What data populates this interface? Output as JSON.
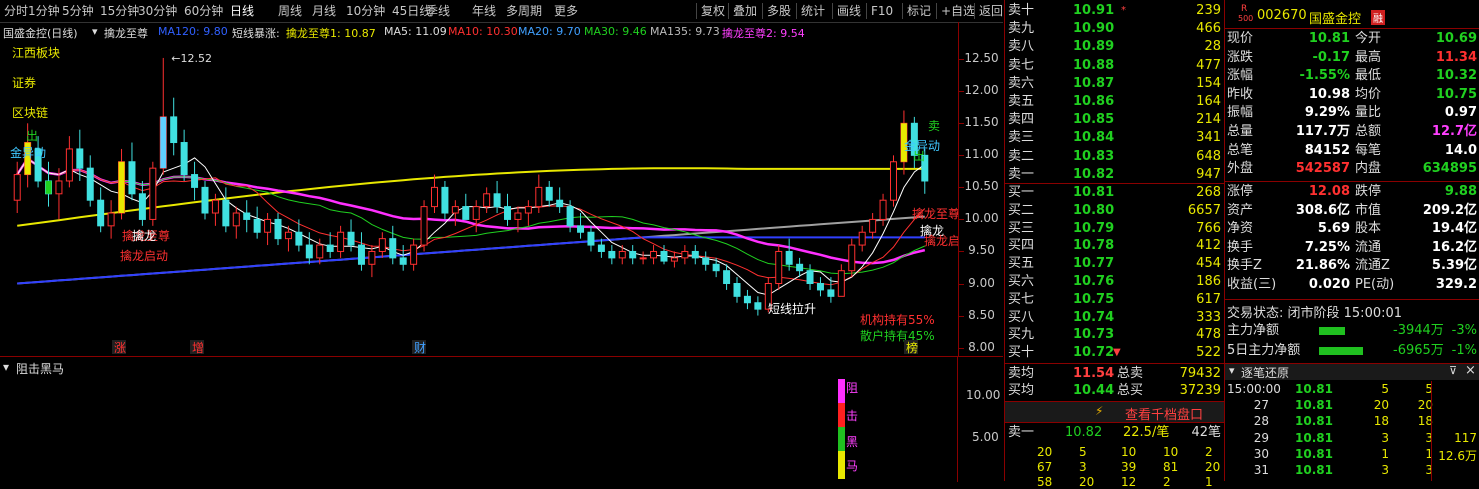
{
  "toolbar": {
    "tabs": [
      "分时",
      "1分钟",
      "5分钟",
      "15分钟",
      "30分钟",
      "60分钟",
      "日线",
      "周线",
      "月线",
      "10分钟",
      "45日线",
      "季线",
      "年线",
      "多周期",
      "更多"
    ],
    "active_tab": "日线",
    "right_buttons": [
      "复权",
      "叠加",
      "多股",
      "统计",
      "画线",
      "F10",
      "标记",
      "+自选",
      "返回"
    ]
  },
  "titlerow": {
    "stock": "国盛金控(日线)",
    "indicator": "擒龙至尊",
    "ma120": "MA120: 9.80",
    "short_label": "短线暴涨:",
    "ind1": "擒龙至尊1: 10.87",
    "ma5": "MA5: 11.09",
    "ma10": "MA10: 10.30",
    "ma20": "MA20: 9.70",
    "ma30": "MA30: 9.46",
    "ma135": "MA135: 9.73",
    "ind2": "擒龙至尊2: 9.54"
  },
  "chart_data": {
    "type": "candlestick",
    "title": "国盛金控(日线)",
    "ylim": [
      7.9,
      12.8
    ],
    "yticks": [
      "12.50",
      "12.00",
      "11.50",
      "11.00",
      "10.50",
      "10.00",
      "9.50",
      "9.00",
      "8.50",
      "8.00"
    ],
    "ytick_values": [
      12.5,
      12.0,
      11.5,
      11.0,
      10.5,
      10.0,
      9.5,
      9.0,
      8.5,
      8.0
    ],
    "high_label": "12.52",
    "high_value": 12.52,
    "candles": [
      [
        10.3,
        10.9,
        10.1,
        10.7
      ],
      [
        10.7,
        11.5,
        10.5,
        11.2
      ],
      [
        11.1,
        11.3,
        10.5,
        10.6
      ],
      [
        10.6,
        10.9,
        10.2,
        10.4
      ],
      [
        10.4,
        10.8,
        10.0,
        10.6
      ],
      [
        10.6,
        11.3,
        10.5,
        11.1
      ],
      [
        11.1,
        11.4,
        10.6,
        10.8
      ],
      [
        10.8,
        11.0,
        10.2,
        10.3
      ],
      [
        10.3,
        10.5,
        9.8,
        9.9
      ],
      [
        9.9,
        10.3,
        9.7,
        10.1
      ],
      [
        10.1,
        11.1,
        10.0,
        10.9
      ],
      [
        10.9,
        11.2,
        10.3,
        10.4
      ],
      [
        10.4,
        10.6,
        9.9,
        10.0
      ],
      [
        10.0,
        10.9,
        9.9,
        10.8
      ],
      [
        10.8,
        12.52,
        10.7,
        11.6
      ],
      [
        11.6,
        11.9,
        11.0,
        11.2
      ],
      [
        11.2,
        11.4,
        10.6,
        10.7
      ],
      [
        10.7,
        10.9,
        10.3,
        10.5
      ],
      [
        10.5,
        10.6,
        10.0,
        10.1
      ],
      [
        10.1,
        10.4,
        9.9,
        10.3
      ],
      [
        10.3,
        10.5,
        9.8,
        9.9
      ],
      [
        9.9,
        10.2,
        9.7,
        10.1
      ],
      [
        10.1,
        10.3,
        9.8,
        10.0
      ],
      [
        10.0,
        10.2,
        9.7,
        9.8
      ],
      [
        9.8,
        10.1,
        9.6,
        10.0
      ],
      [
        10.0,
        10.1,
        9.6,
        9.7
      ],
      [
        9.7,
        9.9,
        9.5,
        9.8
      ],
      [
        9.8,
        10.0,
        9.5,
        9.6
      ],
      [
        9.6,
        9.8,
        9.3,
        9.4
      ],
      [
        9.4,
        9.7,
        9.3,
        9.6
      ],
      [
        9.6,
        9.8,
        9.4,
        9.5
      ],
      [
        9.5,
        9.9,
        9.4,
        9.8
      ],
      [
        9.8,
        10.0,
        9.5,
        9.6
      ],
      [
        9.6,
        9.8,
        9.2,
        9.3
      ],
      [
        9.3,
        9.6,
        9.1,
        9.5
      ],
      [
        9.5,
        9.8,
        9.4,
        9.7
      ],
      [
        9.7,
        9.9,
        9.3,
        9.4
      ],
      [
        9.4,
        9.6,
        9.2,
        9.3
      ],
      [
        9.3,
        9.7,
        9.2,
        9.6
      ],
      [
        9.6,
        10.3,
        9.5,
        10.2
      ],
      [
        10.2,
        10.7,
        10.1,
        10.5
      ],
      [
        10.5,
        10.6,
        10.0,
        10.1
      ],
      [
        10.1,
        10.3,
        9.9,
        10.2
      ],
      [
        10.2,
        10.4,
        10.0,
        10.0
      ],
      [
        10.0,
        10.3,
        9.8,
        10.2
      ],
      [
        10.2,
        10.5,
        10.1,
        10.4
      ],
      [
        10.4,
        10.6,
        10.1,
        10.2
      ],
      [
        10.2,
        10.4,
        9.9,
        10.0
      ],
      [
        10.0,
        10.2,
        9.8,
        10.1
      ],
      [
        10.1,
        10.3,
        9.9,
        10.2
      ],
      [
        10.2,
        10.7,
        10.1,
        10.5
      ],
      [
        10.5,
        10.6,
        10.2,
        10.3
      ],
      [
        10.3,
        10.5,
        10.1,
        10.2
      ],
      [
        10.2,
        10.3,
        9.8,
        9.9
      ],
      [
        9.9,
        10.1,
        9.7,
        9.8
      ],
      [
        9.8,
        9.9,
        9.5,
        9.6
      ],
      [
        9.6,
        9.7,
        9.4,
        9.5
      ],
      [
        9.5,
        9.6,
        9.3,
        9.4
      ],
      [
        9.4,
        9.6,
        9.3,
        9.5
      ],
      [
        9.5,
        9.6,
        9.3,
        9.4
      ],
      [
        9.4,
        9.5,
        9.3,
        9.4
      ],
      [
        9.4,
        9.6,
        9.3,
        9.5
      ],
      [
        9.5,
        9.6,
        9.3,
        9.35
      ],
      [
        9.35,
        9.5,
        9.25,
        9.4
      ],
      [
        9.4,
        9.6,
        9.3,
        9.5
      ],
      [
        9.5,
        9.6,
        9.3,
        9.4
      ],
      [
        9.4,
        9.5,
        9.2,
        9.3
      ],
      [
        9.3,
        9.4,
        9.1,
        9.2
      ],
      [
        9.2,
        9.3,
        8.9,
        9.0
      ],
      [
        9.0,
        9.1,
        8.7,
        8.8
      ],
      [
        8.8,
        8.9,
        8.6,
        8.7
      ],
      [
        8.7,
        8.8,
        8.5,
        8.6
      ],
      [
        8.6,
        9.1,
        8.55,
        9.0
      ],
      [
        9.0,
        9.6,
        8.9,
        9.5
      ],
      [
        9.5,
        9.7,
        9.2,
        9.3
      ],
      [
        9.3,
        9.4,
        9.1,
        9.2
      ],
      [
        9.2,
        9.3,
        8.9,
        9.0
      ],
      [
        9.0,
        9.1,
        8.8,
        8.9
      ],
      [
        8.9,
        9.1,
        8.7,
        8.8
      ],
      [
        8.8,
        9.3,
        8.8,
        9.2
      ],
      [
        9.2,
        9.7,
        9.1,
        9.6
      ],
      [
        9.6,
        9.9,
        9.5,
        9.8
      ],
      [
        9.8,
        10.1,
        9.7,
        10.0
      ],
      [
        10.0,
        10.4,
        9.9,
        10.3
      ],
      [
        10.3,
        11.0,
        10.2,
        10.9
      ],
      [
        10.9,
        11.7,
        10.7,
        11.5
      ],
      [
        11.5,
        11.6,
        10.8,
        11.0
      ],
      [
        11.0,
        11.1,
        10.4,
        10.6
      ]
    ],
    "annotations": [
      "出",
      "卖",
      "金异动",
      "擒龙至尊",
      "擒龙",
      "擒龙启动",
      "短线拉升",
      "机构持有55%",
      "散户持有45%"
    ],
    "sector_tags": [
      "江西板块",
      "证券",
      "区块链"
    ],
    "bottom_tags": [
      "涨",
      "增",
      "财",
      "榜"
    ]
  },
  "lower_panel": {
    "title": "阻击黑马",
    "yticks": [
      "10.00",
      "5.00"
    ],
    "marker_text": [
      "阻",
      "击",
      "黑",
      "马"
    ]
  },
  "book": {
    "sells": [
      {
        "label": "卖十",
        "price": "10.91",
        "vol": "239",
        "mark": "*"
      },
      {
        "label": "卖九",
        "price": "10.90",
        "vol": "466"
      },
      {
        "label": "卖八",
        "price": "10.89",
        "vol": "28"
      },
      {
        "label": "卖七",
        "price": "10.88",
        "vol": "477"
      },
      {
        "label": "卖六",
        "price": "10.87",
        "vol": "154"
      },
      {
        "label": "卖五",
        "price": "10.86",
        "vol": "164"
      },
      {
        "label": "卖四",
        "price": "10.85",
        "vol": "214"
      },
      {
        "label": "卖三",
        "price": "10.84",
        "vol": "341"
      },
      {
        "label": "卖二",
        "price": "10.83",
        "vol": "648"
      },
      {
        "label": "卖一",
        "price": "10.82",
        "vol": "947"
      }
    ],
    "buys": [
      {
        "label": "买一",
        "price": "10.81",
        "vol": "268"
      },
      {
        "label": "买二",
        "price": "10.80",
        "vol": "6657"
      },
      {
        "label": "买三",
        "price": "10.79",
        "vol": "766"
      },
      {
        "label": "买四",
        "price": "10.78",
        "vol": "412"
      },
      {
        "label": "买五",
        "price": "10.77",
        "vol": "454"
      },
      {
        "label": "买六",
        "price": "10.76",
        "vol": "186"
      },
      {
        "label": "买七",
        "price": "10.75",
        "vol": "617"
      },
      {
        "label": "买八",
        "price": "10.74",
        "vol": "333"
      },
      {
        "label": "买九",
        "price": "10.73",
        "vol": "478"
      },
      {
        "label": "买十",
        "price": "10.72",
        "vol": "522",
        "mark": "▼"
      }
    ],
    "avg": {
      "sell_label": "卖均",
      "sell_price": "11.54",
      "sell_total_label": "总卖",
      "sell_total": "79432",
      "buy_label": "买均",
      "buy_price": "10.44",
      "buy_total_label": "总买",
      "buy_total": "37239"
    },
    "view_more": "查看千档盘口",
    "queue": {
      "label": "卖一",
      "price": "10.82",
      "per": "22.5/笔",
      "count": "42笔"
    },
    "queue_rows": [
      [
        "20",
        "5",
        "10",
        "10",
        "2"
      ],
      [
        "67",
        "3",
        "39",
        "81",
        "20"
      ],
      [
        "58",
        "20",
        "12",
        "2",
        "1"
      ]
    ]
  },
  "info": {
    "r_label": "R",
    "r_sub": "500",
    "code": "002670",
    "name": "国盛金控",
    "badge": "融",
    "rows": [
      [
        "现价",
        "10.81",
        "今开",
        "10.69"
      ],
      [
        "涨跌",
        "-0.17",
        "最高",
        "11.34"
      ],
      [
        "涨幅",
        "-1.55%",
        "最低",
        "10.32"
      ],
      [
        "昨收",
        "10.98",
        "均价",
        "10.75"
      ],
      [
        "振幅",
        "9.29%",
        "量比",
        "0.97"
      ],
      [
        "总量",
        "117.7万",
        "总额",
        "12.7亿"
      ],
      [
        "总笔",
        "84152",
        "每笔",
        "14.0"
      ],
      [
        "外盘",
        "542587",
        "内盘",
        "634895"
      ]
    ],
    "rows2": [
      [
        "涨停",
        "12.08",
        "跌停",
        "9.88"
      ],
      [
        "资产",
        "308.6亿",
        "市值",
        "209.2亿"
      ],
      [
        "净资",
        "5.69",
        "股本",
        "19.4亿"
      ],
      [
        "换手",
        "7.25%",
        "流通",
        "16.2亿"
      ],
      [
        "换手Z",
        "21.86%",
        "流通Z",
        "5.39亿"
      ],
      [
        "收益(三)",
        "0.020",
        "PE(动)",
        "329.2"
      ]
    ],
    "trade_status": "交易状态: 闭市阶段 15:00:01",
    "flow1_label": "主力净额",
    "flow1_val": "-3944万",
    "flow1_pct": "-3%",
    "flow2_label": "5日主力净额",
    "flow2_val": "-6965万",
    "flow2_pct": "-1%",
    "tick_title": "逐笔还原",
    "ticks": [
      [
        "15:00:00",
        "10.81",
        "5",
        "5",
        ""
      ],
      [
        "27",
        "10.81",
        "20",
        "20",
        ""
      ],
      [
        "28",
        "10.81",
        "18",
        "18",
        ""
      ],
      [
        "29",
        "10.81",
        "3",
        "3",
        "117"
      ],
      [
        "30",
        "10.81",
        "1",
        "1",
        "12.6万"
      ],
      [
        "31",
        "10.81",
        "3",
        "3",
        ""
      ]
    ]
  }
}
